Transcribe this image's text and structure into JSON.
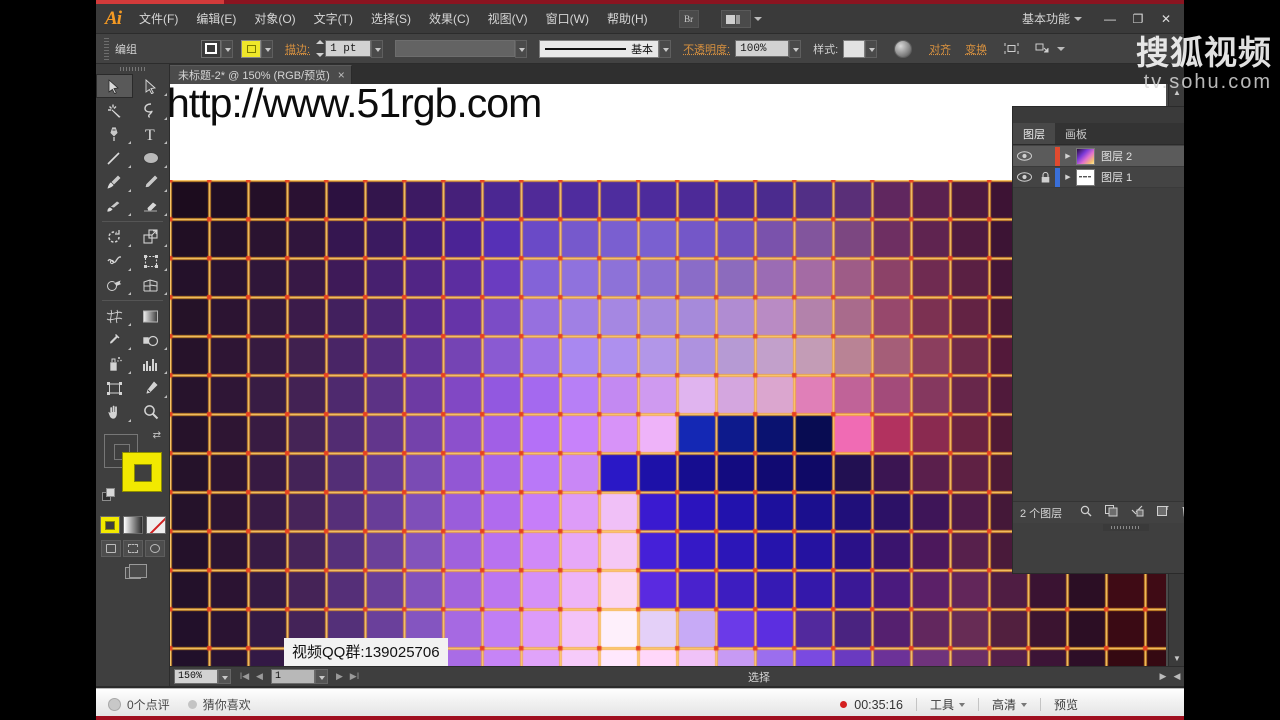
{
  "app": {
    "logo": "Ai",
    "menus": [
      "文件(F)",
      "编辑(E)",
      "对象(O)",
      "文字(T)",
      "选择(S)",
      "效果(C)",
      "视图(V)",
      "窗口(W)",
      "帮助(H)"
    ],
    "bridge_label": "Br",
    "workspace": "基本功能",
    "window_buttons": {
      "minimize": "—",
      "maximize": "❐",
      "close": "✕"
    }
  },
  "control_bar": {
    "selection_label": "编组",
    "stroke_color_label": "?",
    "fill_color": "#efe72a",
    "stroke_label": "描边:",
    "stroke_weight": "1 pt",
    "profile_label": "基本",
    "opacity_label": "不透明度:",
    "opacity_value": "100%",
    "style_label": "样式:",
    "align_label": "对齐",
    "transform_label": "变换",
    "accent_color": "#d8913f"
  },
  "document": {
    "tab_title": "未标题-2* @ 150% (RGB/预览)",
    "tab_close": "×",
    "canvas_text": "http://www.51rgb.com"
  },
  "status_bar": {
    "zoom": "150%",
    "artboard_number": "1",
    "tool_name": "选择",
    "first": "I◀",
    "prev": "◀",
    "next": "▶",
    "last": "▶I",
    "scroll_right": "▶",
    "scroll_left": "◀"
  },
  "layers_panel": {
    "collapse_icon": "◀◀",
    "close_icon": "✕",
    "tabs": [
      {
        "label": "图层",
        "active": true
      },
      {
        "label": "画板",
        "active": false
      }
    ],
    "menu_icon": "▾☰",
    "layers": [
      {
        "name": "图层 2",
        "visible": true,
        "locked": false,
        "color": "#e04a2f",
        "selected": true,
        "thumb": "gradient",
        "target_circle": "○",
        "select_square": "■"
      },
      {
        "name": "图层 1",
        "visible": true,
        "locked": true,
        "color": "#3a6fd8",
        "selected": false,
        "thumb": "text",
        "target_circle": "○",
        "select_square": ""
      }
    ],
    "footer_count": "2 个图层",
    "footer_icons": [
      "search-icon",
      "new-sublayer-icon",
      "make-clipping-mask-icon",
      "new-layer-icon",
      "delete-layer-icon"
    ]
  },
  "overlays": {
    "qq_group": "视频QQ群:139025706",
    "watermark_cn": "搜狐视频",
    "watermark_en": "tv.sohu.com"
  },
  "video_player": {
    "comment_count": "0个点评",
    "recommend": "猜你喜欢",
    "time": "00:35:16",
    "tools": "工具",
    "quality": "高清",
    "preview": "预览"
  },
  "toolbox": {
    "tools": [
      "selection-tool",
      "direct-selection-tool",
      "magic-wand-tool",
      "lasso-tool",
      "pen-tool",
      "type-tool",
      "line-segment-tool",
      "ellipse-tool",
      "paintbrush-tool",
      "pencil-tool",
      "blob-brush-tool",
      "eraser-tool",
      "rotate-tool",
      "scale-tool",
      "width-tool",
      "free-transform-tool",
      "shape-builder-tool",
      "perspective-grid-tool",
      "mesh-tool",
      "gradient-tool",
      "eyedropper-tool",
      "blend-tool",
      "symbol-sprayer-tool",
      "column-graph-tool",
      "artboard-tool",
      "slice-tool",
      "hand-tool",
      "zoom-tool"
    ],
    "fill_color": "#f2e900",
    "stroke_color": "none"
  },
  "artwork": {
    "description": "grid of colored squares with orange selection guides",
    "guide_color": "#f5a623",
    "anchor_color": "#e8401f",
    "cols": 24,
    "rows": 13,
    "cell": 39,
    "grid_colors": [
      [
        "#1c0c1e",
        "#200e24",
        "#240f28",
        "#2a1132",
        "#2c1140",
        "#33154c",
        "#3d1a63",
        "#46207a",
        "#4b2792",
        "#502a98",
        "#4f2c9e",
        "#4e2d9e",
        "#4d2b9c",
        "#4d2a98",
        "#4c2a94",
        "#4b2b8e",
        "#522f86",
        "#5a2f78",
        "#60275f",
        "#5a2150",
        "#4d1a40",
        "#3d1334",
        "#2c0e26",
        "#22091c"
      ],
      [
        "#210f24",
        "#25112a",
        "#2a1330",
        "#30153c",
        "#351650",
        "#3b1a60",
        "#431d78",
        "#4b2395",
        "#5630b6",
        "#6a4ac7",
        "#7659cc",
        "#7a5fd0",
        "#7a60d0",
        "#7457c8",
        "#7150bb",
        "#7a52ac",
        "#82559d",
        "#7c4781",
        "#6e2f62",
        "#5f2450",
        "#4e1b40",
        "#3c1434",
        "#2e0f27",
        "#230a1e"
      ],
      [
        "#24112a",
        "#2a1330",
        "#2f1639",
        "#371845",
        "#3e1a58",
        "#47206f",
        "#512585",
        "#5c2da0",
        "#6a3cc0",
        "#8363d8",
        "#8f72dd",
        "#8d72d8",
        "#8b6fd2",
        "#8a6cc8",
        "#8c6bbd",
        "#9b6cb4",
        "#a46ba4",
        "#9e5c87",
        "#8c4268",
        "#6f2b51",
        "#5a2043",
        "#431637",
        "#321029",
        "#260b20"
      ],
      [
        "#251228",
        "#2c1432",
        "#33183c",
        "#3b1b4a",
        "#42205e",
        "#4c2572",
        "#58298c",
        "#6634a8",
        "#7b4cc6",
        "#9670df",
        "#a080e4",
        "#a587e2",
        "#a589de",
        "#a68ada",
        "#b08cd2",
        "#b98bc4",
        "#b382ab",
        "#a96b8c",
        "#97486c",
        "#7c3152",
        "#632344",
        "#4a1837",
        "#37112b",
        "#280c21"
      ],
      [
        "#26122a",
        "#2e1534",
        "#361a40",
        "#40204f",
        "#492566",
        "#552c7c",
        "#643498",
        "#7544b4",
        "#8a5ad2",
        "#9e72e6",
        "#a988f0",
        "#ae90ee",
        "#b296e8",
        "#ae92df",
        "#b69ad4",
        "#c2a0cb",
        "#c39cb6",
        "#b98395",
        "#a55e78",
        "#8b3e5e",
        "#6d2a4a",
        "#53193a",
        "#3c132e",
        "#2b0d22"
      ],
      [
        "#27132c",
        "#2f1636",
        "#381c44",
        "#432254",
        "#4e296e",
        "#5c3285",
        "#6d3aa3",
        "#8148c4",
        "#9258e0",
        "#a469ef",
        "#b77ff6",
        "#c389f2",
        "#cf9af0",
        "#e0b4ef",
        "#d4a6df",
        "#dba6cf",
        "#e07fb8",
        "#c06398",
        "#a34b7a",
        "#85385f",
        "#68274b",
        "#501a3b",
        "#3a122e",
        "#2a0d22"
      ],
      [
        "#26122a",
        "#2e1533",
        "#381b42",
        "#452456",
        "#522c72",
        "#62368c",
        "#7442ab",
        "#8c50cc",
        "#a15fe6",
        "#b470f7",
        "#c782fa",
        "#d793f8",
        "#eeb3f9",
        "#1428b4",
        "#0d1a8c",
        "#0a1270",
        "#080c52",
        "#f06bb4",
        "#b2325f",
        "#8a2a50",
        "#6a2342",
        "#4f1936",
        "#3a122c",
        "#2a0d21"
      ],
      [
        "#25122a",
        "#2d1432",
        "#371a42",
        "#442357",
        "#532e76",
        "#653a93",
        "#7a4bb4",
        "#9257d4",
        "#a866ea",
        "#b978f8",
        "#c987f6",
        "#2a18c6",
        "#1d11a8",
        "#160d90",
        "#130b80",
        "#110a72",
        "#0f0966",
        "#221052",
        "#3b1552",
        "#5a1f4c",
        "#5f2144",
        "#4c1a37",
        "#39122c",
        "#2a0d21"
      ],
      [
        "#25122a",
        "#2d1432",
        "#381b44",
        "#472459",
        "#562f79",
        "#683d98",
        "#7f4fb9",
        "#9a5ddb",
        "#b06bee",
        "#c67ef9",
        "#dd9cf8",
        "#f0c0f7",
        "#3a1ad0",
        "#2b14bd",
        "#2212ad",
        "#1d109c",
        "#1b0f8e",
        "#200f7a",
        "#2c1166",
        "#3e1558",
        "#4e1b49",
        "#441838",
        "#36112c",
        "#290d21"
      ],
      [
        "#24112a",
        "#2c1432",
        "#371b44",
        "#462458",
        "#56307a",
        "#6b4099",
        "#8353bc",
        "#a061dd",
        "#b872f0",
        "#d089f8",
        "#e6a8f8",
        "#f5c8f5",
        "#4520d8",
        "#3519c6",
        "#2c16b8",
        "#2614ac",
        "#2512a0",
        "#2a1188",
        "#3a146e",
        "#4c185c",
        "#57204c",
        "#491a3a",
        "#38112d",
        "#2a0d22"
      ],
      [
        "#23112a",
        "#2b1332",
        "#351a43",
        "#452357",
        "#552f78",
        "#6a3f98",
        "#8352bb",
        "#a263dc",
        "#bb76f0",
        "#d490f8",
        "#edb4f7",
        "#fbd7f4",
        "#5a2ae0",
        "#4922cd",
        "#3d1dc0",
        "#361ab4",
        "#3418aa",
        "#3a1896",
        "#4a1a7e",
        "#5b2068",
        "#62265a",
        "#4f1d43",
        "#3a1332",
        "#2b0e24"
      ],
      [
        "#22102a",
        "#2a1332",
        "#341a44",
        "#442358",
        "#543079",
        "#6a409b",
        "#8455c0",
        "#a669e2",
        "#c07ef4",
        "#dc9bf9",
        "#f3c3f8",
        "#fef0fb",
        "#e4d0f8",
        "#c7aaf6",
        "#6b3ae8",
        "#5c2ee0",
        "#52299d",
        "#4a2380",
        "#55206f",
        "#62275e",
        "#672c55",
        "#52203f",
        "#3b1430",
        "#2c0e24"
      ],
      [
        "#21102a",
        "#291332",
        "#331945",
        "#422359",
        "#523079",
        "#68409c",
        "#8356c2",
        "#a96ce6",
        "#c684f6",
        "#e0a3fa",
        "#f6cbfa",
        "#ffe8fd",
        "#ffd7fa",
        "#f0c2f8",
        "#c79af4",
        "#9b6eee",
        "#7a4ae0",
        "#6a3ac0",
        "#6c3298",
        "#6f337c",
        "#6a2f66",
        "#54204a",
        "#3c1436",
        "#2d0e27"
      ]
    ],
    "right_strip_colors": [
      "#3d0b14",
      "#4a0d18",
      "#55101c",
      "#5e1220",
      "#5f1322",
      "#5a1220",
      "#530f1d",
      "#4c0e1a",
      "#470d19",
      "#430c17",
      "#3f0b15",
      "#3a0a14",
      "#350912"
    ]
  }
}
